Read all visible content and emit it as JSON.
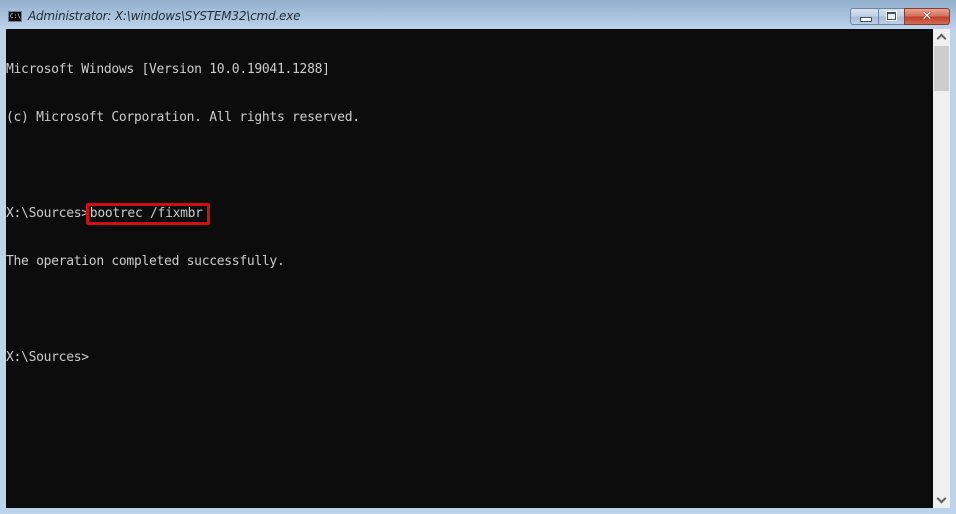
{
  "window": {
    "title": "Administrator: X:\\windows\\SYSTEM32\\cmd.exe",
    "icon": "cmd-icon",
    "icon_text": "C:\\_",
    "buttons": {
      "minimize": "minimize-icon",
      "maximize": "maximize-icon",
      "close": "close-icon",
      "close_glyph": "✕"
    }
  },
  "console": {
    "lines": [
      "Microsoft Windows [Version 10.0.19041.1288]",
      "(c) Microsoft Corporation. All rights reserved.",
      "",
      "",
      "The operation completed successfully.",
      "",
      "X:\\Sources>"
    ],
    "command_prompt": "X:\\Sources>",
    "command_text": "bootrec /fixmbr",
    "highlight_color": "#d00f14",
    "background_color": "#0c0c0c",
    "text_color": "#cccccc"
  },
  "scrollbar": {
    "up_icon": "chevron-up-icon",
    "down_icon": "chevron-down-icon",
    "position_fraction": 0.0
  }
}
